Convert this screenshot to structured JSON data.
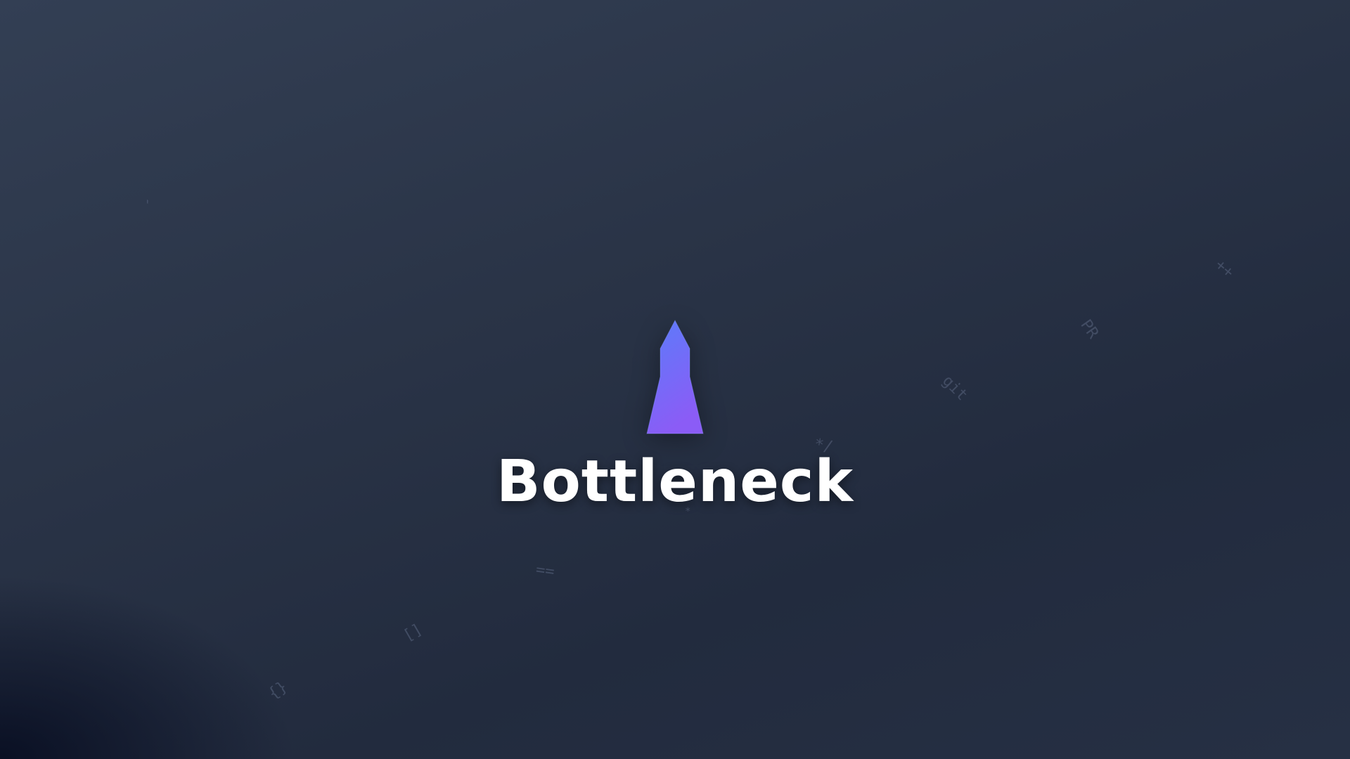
{
  "app": {
    "title": "Bottleneck",
    "logo_icon": "bottleneck-logo-icon"
  },
  "colors": {
    "background_top": "#333f54",
    "background_bottom": "#222b3e",
    "logo_gradient_start": "#5b7cfa",
    "logo_gradient_end": "#8b5cf6",
    "title_color": "#ffffff"
  },
  "background_glyphs": [
    {
      "text": "`"
    },
    {
      "text": "++"
    },
    {
      "text": "PR"
    },
    {
      "text": "git"
    },
    {
      "text": "*/"
    },
    {
      "text": "*"
    },
    {
      "text": "=="
    },
    {
      "text": "[]"
    },
    {
      "text": "{}"
    }
  ]
}
